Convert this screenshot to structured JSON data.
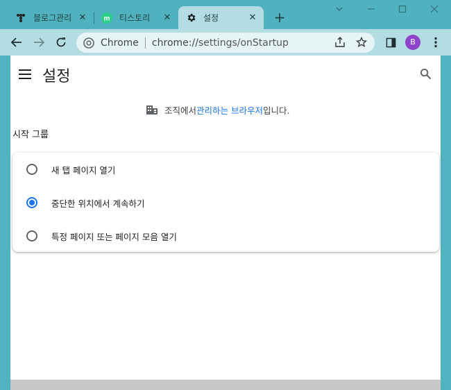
{
  "tabs": [
    {
      "title": "블로그관리",
      "favicon": "tistory-dots-icon",
      "active": false
    },
    {
      "title": "티스토리",
      "favicon": "tistory-m-icon",
      "active": false
    },
    {
      "title": "설정",
      "favicon": "gear-icon",
      "active": true
    }
  ],
  "toolbar": {
    "chip_label": "Chrome",
    "url_scheme": "chrome://",
    "url_path": "settings/onStartup",
    "avatar_letter": "B"
  },
  "page": {
    "title": "설정",
    "managed_prefix": "조직에서 ",
    "managed_link": "관리하는 브라우저",
    "managed_suffix": "입니다.",
    "section_title": "시작 그룹"
  },
  "startup_options": [
    {
      "label": "새 탭 페이지 열기",
      "checked": false
    },
    {
      "label": "중단한 위치에서 계속하기",
      "checked": true
    },
    {
      "label": "특정 페이지 또는 페이지 모음 열기",
      "checked": false
    }
  ],
  "colors": {
    "accent": "#1a73e8",
    "tab_strip": "#50b2bf",
    "toolbar": "#b3dde3"
  }
}
